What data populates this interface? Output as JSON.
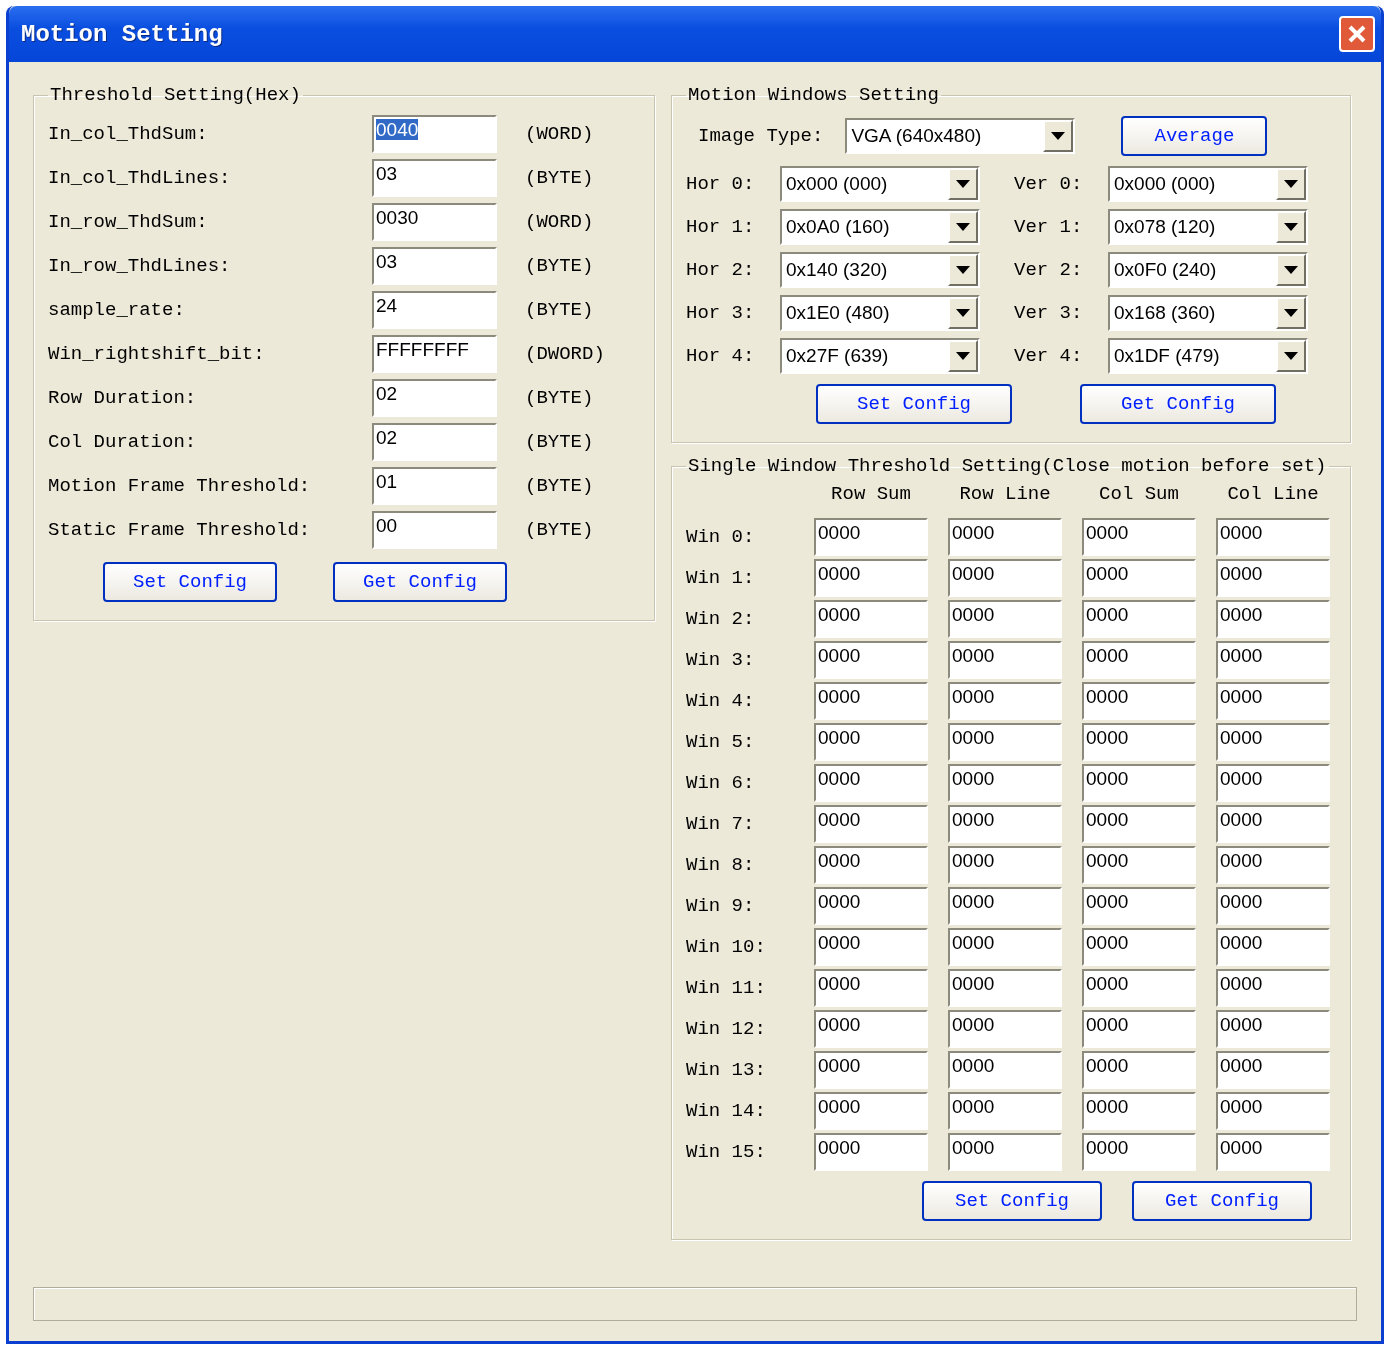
{
  "window": {
    "title": "Motion Setting"
  },
  "threshold": {
    "title": "Threshold Setting(Hex)",
    "rows": [
      {
        "label": "In_col_ThdSum:",
        "value": "0040",
        "unit": "(WORD)",
        "selected": true
      },
      {
        "label": "In_col_ThdLines:",
        "value": "03",
        "unit": "(BYTE)",
        "selected": false
      },
      {
        "label": "In_row_ThdSum:",
        "value": "0030",
        "unit": "(WORD)",
        "selected": false
      },
      {
        "label": "In_row_ThdLines:",
        "value": "03",
        "unit": "(BYTE)",
        "selected": false
      },
      {
        "label": "sample_rate:",
        "value": "24",
        "unit": "(BYTE)",
        "selected": false
      },
      {
        "label": "Win_rightshift_bit:",
        "value": "FFFFFFFF",
        "unit": "(DWORD)",
        "selected": false
      },
      {
        "label": "Row Duration:",
        "value": "02",
        "unit": "(BYTE)",
        "selected": false
      },
      {
        "label": "Col Duration:",
        "value": "02",
        "unit": "(BYTE)",
        "selected": false
      },
      {
        "label": "Motion Frame Threshold:",
        "value": "01",
        "unit": "(BYTE)",
        "selected": false
      },
      {
        "label": "Static Frame Threshold:",
        "value": "00",
        "unit": "(BYTE)",
        "selected": false
      }
    ],
    "buttons": [
      "Set Config",
      "Get Config"
    ]
  },
  "motion_windows": {
    "title": "Motion Windows Setting",
    "image_type": {
      "label": "Image Type:",
      "value": "VGA (640x480)"
    },
    "average_button": "Average",
    "hor": [
      {
        "label": "Hor 0:",
        "value": "0x000 (000)"
      },
      {
        "label": "Hor 1:",
        "value": "0x0A0 (160)"
      },
      {
        "label": "Hor 2:",
        "value": "0x140 (320)"
      },
      {
        "label": "Hor 3:",
        "value": "0x1E0 (480)"
      },
      {
        "label": "Hor 4:",
        "value": "0x27F (639)"
      }
    ],
    "ver": [
      {
        "label": "Ver 0:",
        "value": "0x000 (000)"
      },
      {
        "label": "Ver 1:",
        "value": "0x078 (120)"
      },
      {
        "label": "Ver 2:",
        "value": "0x0F0 (240)"
      },
      {
        "label": "Ver 3:",
        "value": "0x168 (360)"
      },
      {
        "label": "Ver 4:",
        "value": "0x1DF (479)"
      }
    ],
    "buttons": [
      "Set Config",
      "Get Config"
    ]
  },
  "single_window": {
    "title": "Single Window Threshold Setting(Close motion before set)",
    "columns": [
      "Row Sum",
      "Row Line",
      "Col Sum",
      "Col Line"
    ],
    "rows": [
      {
        "label": "Win 0:",
        "values": [
          "0000",
          "0000",
          "0000",
          "0000"
        ]
      },
      {
        "label": "Win 1:",
        "values": [
          "0000",
          "0000",
          "0000",
          "0000"
        ]
      },
      {
        "label": "Win 2:",
        "values": [
          "0000",
          "0000",
          "0000",
          "0000"
        ]
      },
      {
        "label": "Win 3:",
        "values": [
          "0000",
          "0000",
          "0000",
          "0000"
        ]
      },
      {
        "label": "Win 4:",
        "values": [
          "0000",
          "0000",
          "0000",
          "0000"
        ]
      },
      {
        "label": "Win 5:",
        "values": [
          "0000",
          "0000",
          "0000",
          "0000"
        ]
      },
      {
        "label": "Win 6:",
        "values": [
          "0000",
          "0000",
          "0000",
          "0000"
        ]
      },
      {
        "label": "Win 7:",
        "values": [
          "0000",
          "0000",
          "0000",
          "0000"
        ]
      },
      {
        "label": "Win 8:",
        "values": [
          "0000",
          "0000",
          "0000",
          "0000"
        ]
      },
      {
        "label": "Win 9:",
        "values": [
          "0000",
          "0000",
          "0000",
          "0000"
        ]
      },
      {
        "label": "Win 10:",
        "values": [
          "0000",
          "0000",
          "0000",
          "0000"
        ]
      },
      {
        "label": "Win 11:",
        "values": [
          "0000",
          "0000",
          "0000",
          "0000"
        ]
      },
      {
        "label": "Win 12:",
        "values": [
          "0000",
          "0000",
          "0000",
          "0000"
        ]
      },
      {
        "label": "Win 13:",
        "values": [
          "0000",
          "0000",
          "0000",
          "0000"
        ]
      },
      {
        "label": "Win 14:",
        "values": [
          "0000",
          "0000",
          "0000",
          "0000"
        ]
      },
      {
        "label": "Win 15:",
        "values": [
          "0000",
          "0000",
          "0000",
          "0000"
        ]
      }
    ],
    "buttons": [
      "Set Config",
      "Get Config"
    ]
  }
}
